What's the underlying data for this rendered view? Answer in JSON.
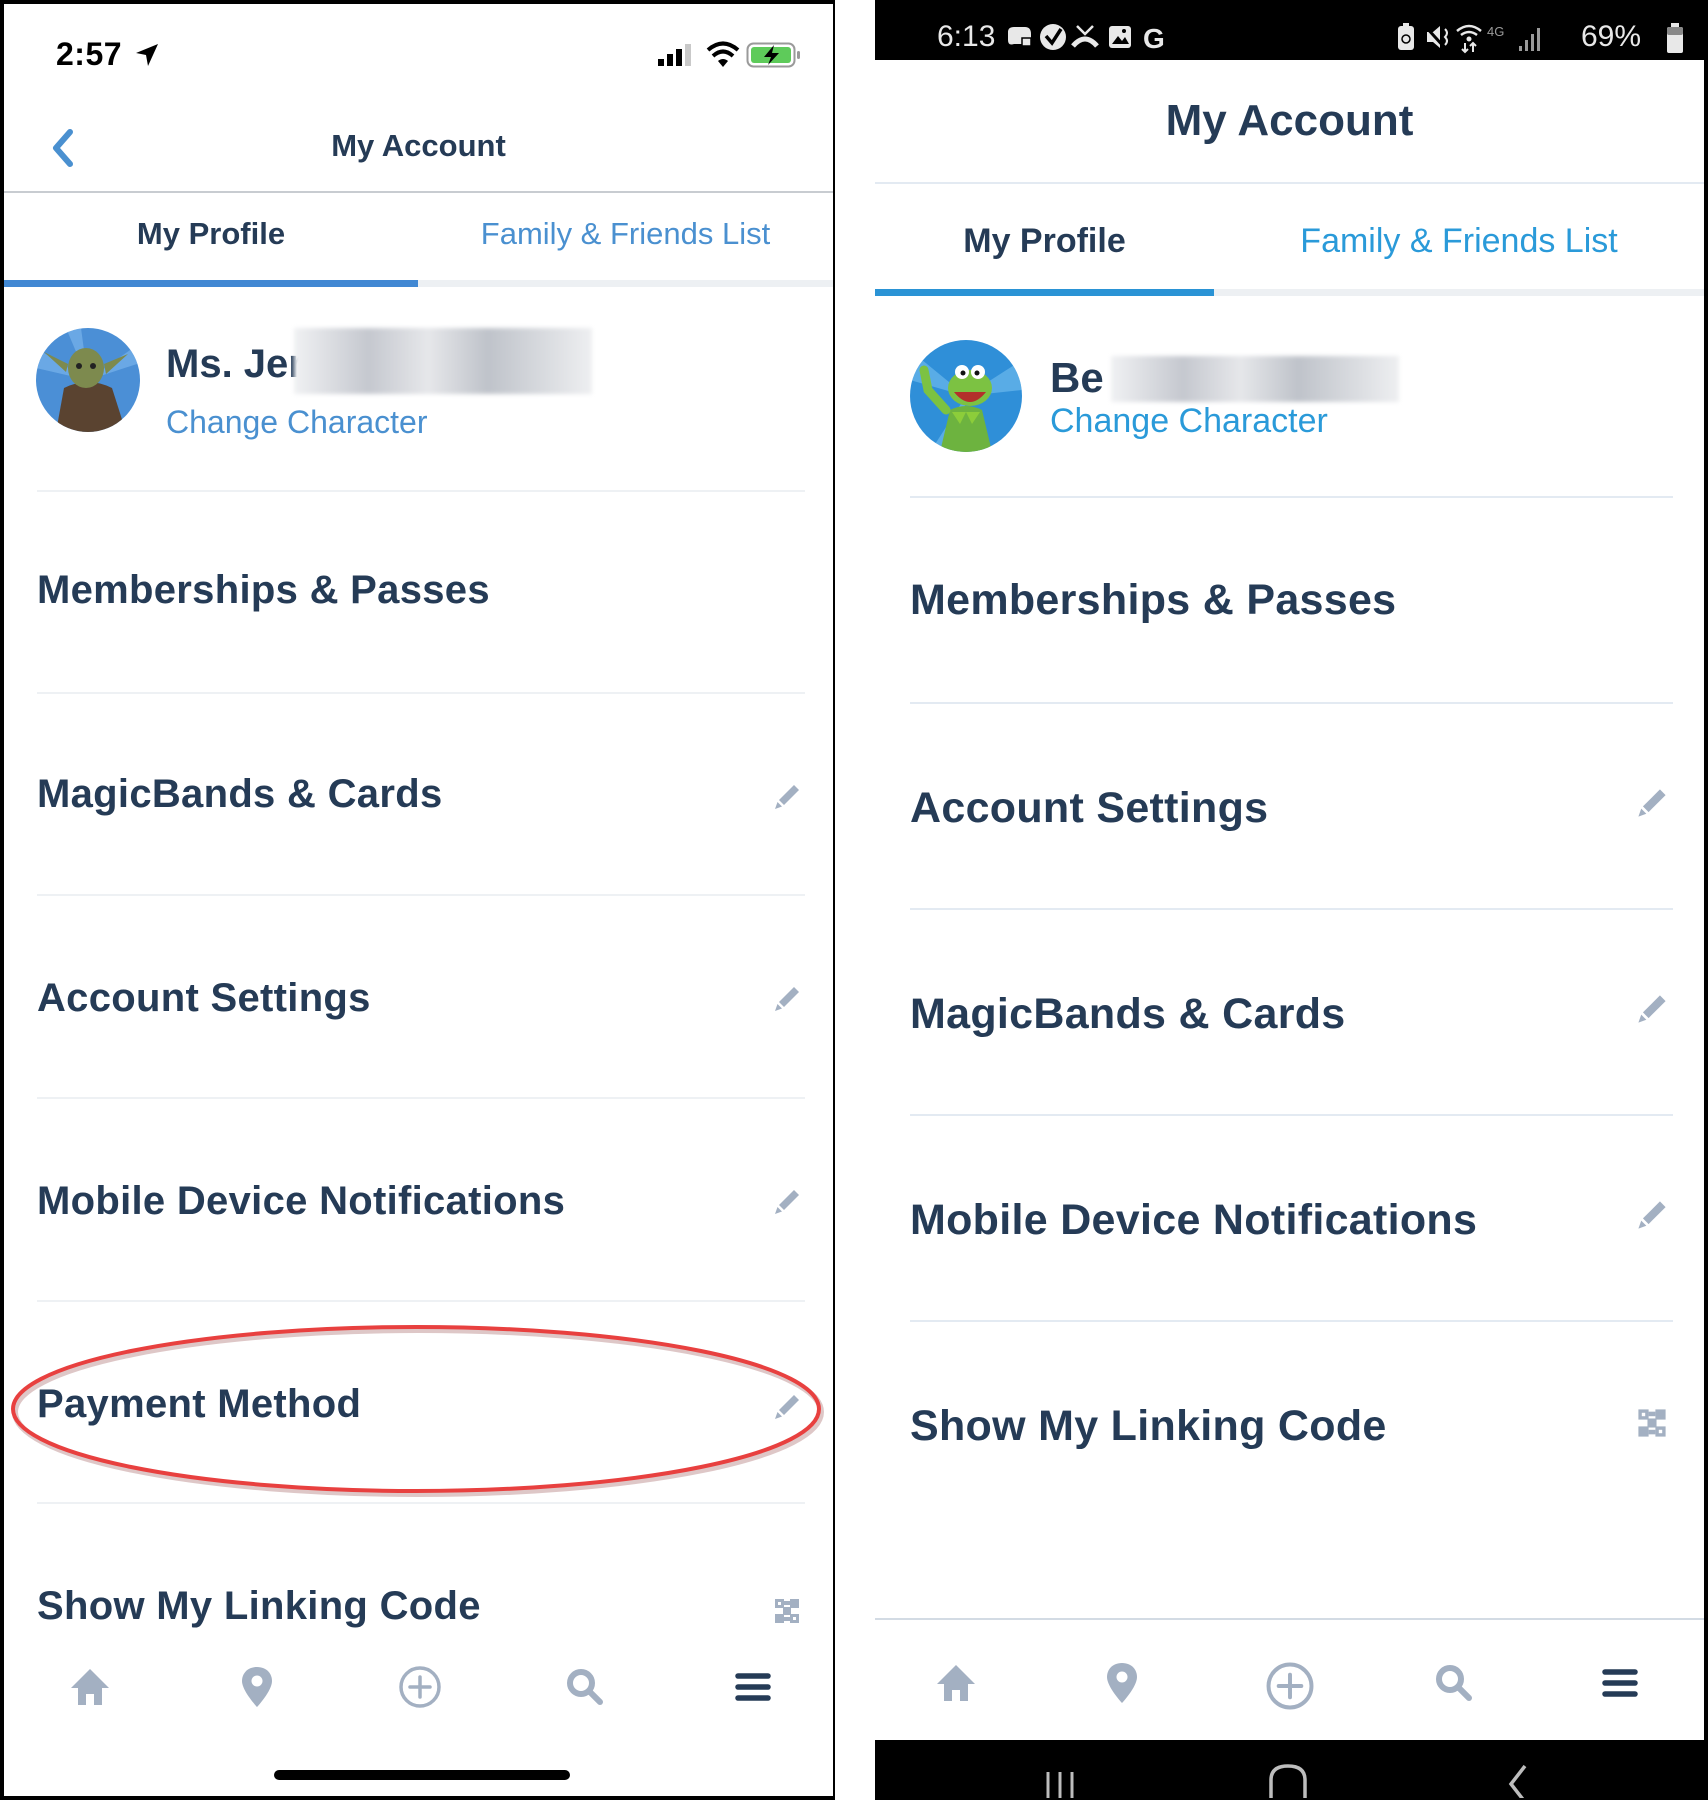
{
  "ios": {
    "status": {
      "time": "2:57",
      "icons": [
        "location-arrow-icon",
        "cellular-signal-icon",
        "wifi-icon",
        "battery-charging-icon"
      ]
    },
    "header": {
      "back_icon": "chevron-left-icon",
      "title": "My Account"
    },
    "tabs": [
      {
        "label": "My Profile",
        "active": true
      },
      {
        "label": "Family & Friends List",
        "active": false
      }
    ],
    "profile": {
      "name_visible": "Ms. Jer",
      "name_redacted": true,
      "avatar": "yoda-character-avatar",
      "change_link": "Change Character"
    },
    "items": [
      {
        "label": "Memberships & Passes",
        "icon": ""
      },
      {
        "label": "MagicBands & Cards",
        "icon": "pencil-icon"
      },
      {
        "label": "Account Settings",
        "icon": "pencil-icon"
      },
      {
        "label": "Mobile Device Notifications",
        "icon": "pencil-icon"
      },
      {
        "label": "Payment Method",
        "icon": "pencil-icon",
        "highlighted": true
      },
      {
        "label": "Show My Linking Code",
        "icon": "qr-code-icon"
      }
    ],
    "bottom_nav": [
      "home-icon",
      "map-pin-icon",
      "add-circle-icon",
      "search-icon",
      "menu-icon"
    ]
  },
  "android": {
    "status": {
      "time": "6:13",
      "battery_percent": "69%",
      "network": "4G LTE",
      "icons": [
        "game-controller-icon",
        "check-circle-icon",
        "missed-call-icon",
        "image-icon",
        "google-icon",
        "battery-saver-icon",
        "mute-icon",
        "wifi-data-icon",
        "signal-icon",
        "battery-icon"
      ]
    },
    "header": {
      "title": "My Account"
    },
    "tabs": [
      {
        "label": "My Profile",
        "active": true
      },
      {
        "label": "Family & Friends List",
        "active": false
      }
    ],
    "profile": {
      "name_visible": "Be",
      "name_redacted": true,
      "avatar": "kermit-character-avatar",
      "change_link": "Change Character"
    },
    "items": [
      {
        "label": "Memberships & Passes",
        "icon": ""
      },
      {
        "label": "Account Settings",
        "icon": "pencil-icon"
      },
      {
        "label": "MagicBands & Cards",
        "icon": "pencil-icon"
      },
      {
        "label": "Mobile Device Notifications",
        "icon": "pencil-icon"
      },
      {
        "label": "Show My Linking Code",
        "icon": "qr-code-icon"
      }
    ],
    "bottom_nav": [
      "home-icon",
      "map-pin-icon",
      "add-circle-icon",
      "search-icon",
      "menu-icon"
    ],
    "system_nav": [
      "recent-apps-icon",
      "home-button-icon",
      "back-icon"
    ]
  },
  "annotation": {
    "type": "red-ellipse",
    "target": "Payment Method",
    "color": "#e8403f"
  },
  "colors": {
    "text_dark": "#253b56",
    "accent_blue": "#4a90d0",
    "icon_gray": "#a3b0c2",
    "tab_indicator": "#4188d3"
  }
}
